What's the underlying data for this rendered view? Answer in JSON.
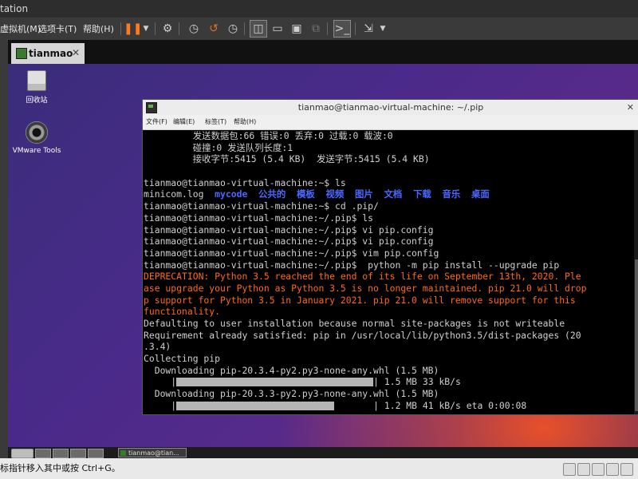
{
  "host": {
    "title": "tation",
    "menu": [
      {
        "label": "虚拟机(M)"
      },
      {
        "label": "选项卡(T)"
      },
      {
        "label": "帮助(H)"
      }
    ],
    "toolbar_icons": [
      "pause-icon",
      "chevron-down-icon",
      "send-keys-icon",
      "snapshot-icon",
      "revert-snapshot-icon",
      "snapshot-manager-icon",
      "console-view-icon",
      "single-window-icon",
      "full-screen-icon",
      "unity-icon",
      "terminal-icon",
      "stretch-icon"
    ],
    "tab": {
      "label": "tianmao"
    },
    "status_text": "标指针移入其中或按 Ctrl+G。"
  },
  "desktop": {
    "icons": [
      {
        "label": "回收站",
        "icon": "trash-icon"
      },
      {
        "label": "VMware Tools",
        "icon": "disc-icon"
      }
    ]
  },
  "terminal": {
    "title": "tianmao@tianmao-virtual-machine: ~/.pip",
    "menu": [
      {
        "label": "文件(F)"
      },
      {
        "label": "编辑(E)"
      },
      {
        "label": "标签(T)"
      },
      {
        "label": "帮助(H)"
      }
    ],
    "lines": [
      {
        "text": "         发送数据包:66 错误:0 丢弃:0 过载:0 载波:0"
      },
      {
        "text": "         碰撞:0 发送队列长度:1"
      },
      {
        "text": "         接收字节:5415 (5.4 KB)  发送字节:5415 (5.4 KB)"
      },
      {
        "text": ""
      },
      {
        "text": "tianmao@tianmao-virtual-machine:~$ ls"
      },
      {
        "prefix": "minicom.log  ",
        "dirs": [
          "mycode",
          "公共的",
          "模板",
          "视频",
          "图片",
          "文档",
          "下载",
          "音乐",
          "桌面"
        ]
      },
      {
        "text": "tianmao@tianmao-virtual-machine:~$ cd .pip/"
      },
      {
        "text": "tianmao@tianmao-virtual-machine:~/.pip$ ls"
      },
      {
        "text": "tianmao@tianmao-virtual-machine:~/.pip$ vi pip.config"
      },
      {
        "text": "tianmao@tianmao-virtual-machine:~/.pip$ vi pip.config"
      },
      {
        "text": "tianmao@tianmao-virtual-machine:~/.pip$ vim pip.config"
      },
      {
        "text": "tianmao@tianmao-virtual-machine:~/.pip$  python -m pip install --upgrade pip"
      },
      {
        "text": "DEPRECATION: Python 3.5 reached the end of its life on September 13th, 2020. Ple",
        "err": true
      },
      {
        "text": "ase upgrade your Python as Python 3.5 is no longer maintained. pip 21.0 will drop",
        "err": true
      },
      {
        "text": "p support for Python 3.5 in January 2021. pip 21.0 will remove support for this",
        "err": true
      },
      {
        "text": "functionality.",
        "err": true
      },
      {
        "text": "Defaulting to user installation because normal site-packages is not writeable"
      },
      {
        "text": "Requirement already satisfied: pip in /usr/local/lib/python3.5/dist-packages (20"
      },
      {
        "text": ".3.4)"
      },
      {
        "text": "Collecting pip"
      },
      {
        "text": "  Downloading pip-20.3.4-py2.py3-none-any.whl (1.5 MB)"
      },
      {
        "progress": 1.0,
        "after": "| 1.5 MB 33 kB/s"
      },
      {
        "text": "  Downloading pip-20.3.3-py2.py3-none-any.whl (1.5 MB)"
      },
      {
        "progress": 0.8,
        "after": "| 1.2 MB 41 kB/s eta 0:00:08"
      }
    ]
  },
  "colors": {
    "error_text": "#ff6a13",
    "dir_text": "#4b68ff",
    "pause_accent": "#ff7a18"
  },
  "taskbar": {
    "task_label": "tianmao@tian..."
  }
}
